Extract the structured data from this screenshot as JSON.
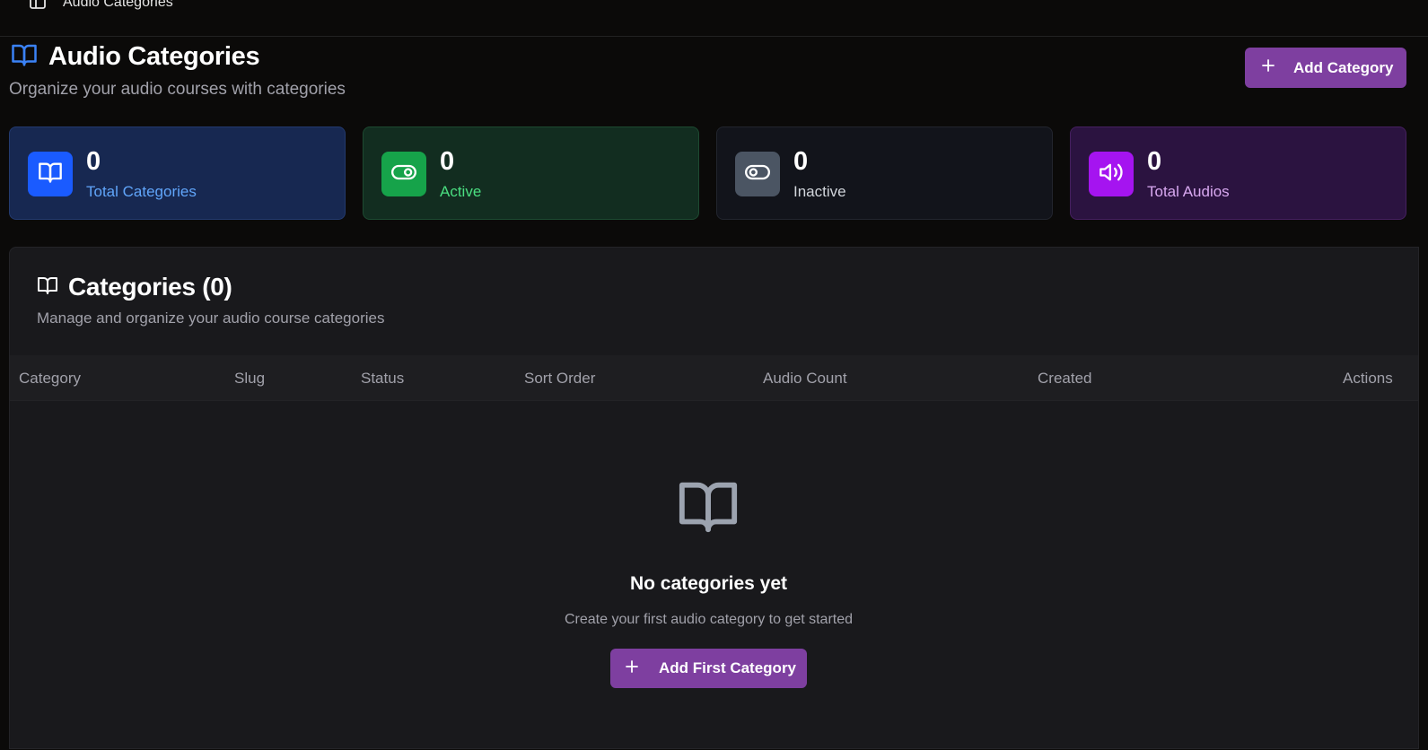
{
  "topbar": {
    "breadcrumb": "Audio Categories"
  },
  "header": {
    "title": "Audio Categories",
    "subtitle": "Organize your audio courses with categories",
    "add_button_label": "Add Category"
  },
  "stats": [
    {
      "value": "0",
      "label": "Total Categories",
      "icon": "book-open-icon",
      "accent": "#1a5bff"
    },
    {
      "value": "0",
      "label": "Active",
      "icon": "toggle-on-icon",
      "accent": "#16a34a"
    },
    {
      "value": "0",
      "label": "Inactive",
      "icon": "toggle-off-icon",
      "accent": "#4b5563"
    },
    {
      "value": "0",
      "label": "Total Audios",
      "icon": "volume-icon",
      "accent": "#a21caf"
    }
  ],
  "panel": {
    "title": "Categories (0)",
    "subtitle": "Manage and organize your audio course categories",
    "columns": [
      "Category",
      "Slug",
      "Status",
      "Sort Order",
      "Audio Count",
      "Created",
      "Actions"
    ]
  },
  "empty_state": {
    "title": "No categories yet",
    "text": "Create your first audio category to get started",
    "button_label": "Add First Category"
  },
  "colors": {
    "primary_button": "#7e3fa0",
    "background": "#0b0a09",
    "panel": "#19191c"
  }
}
